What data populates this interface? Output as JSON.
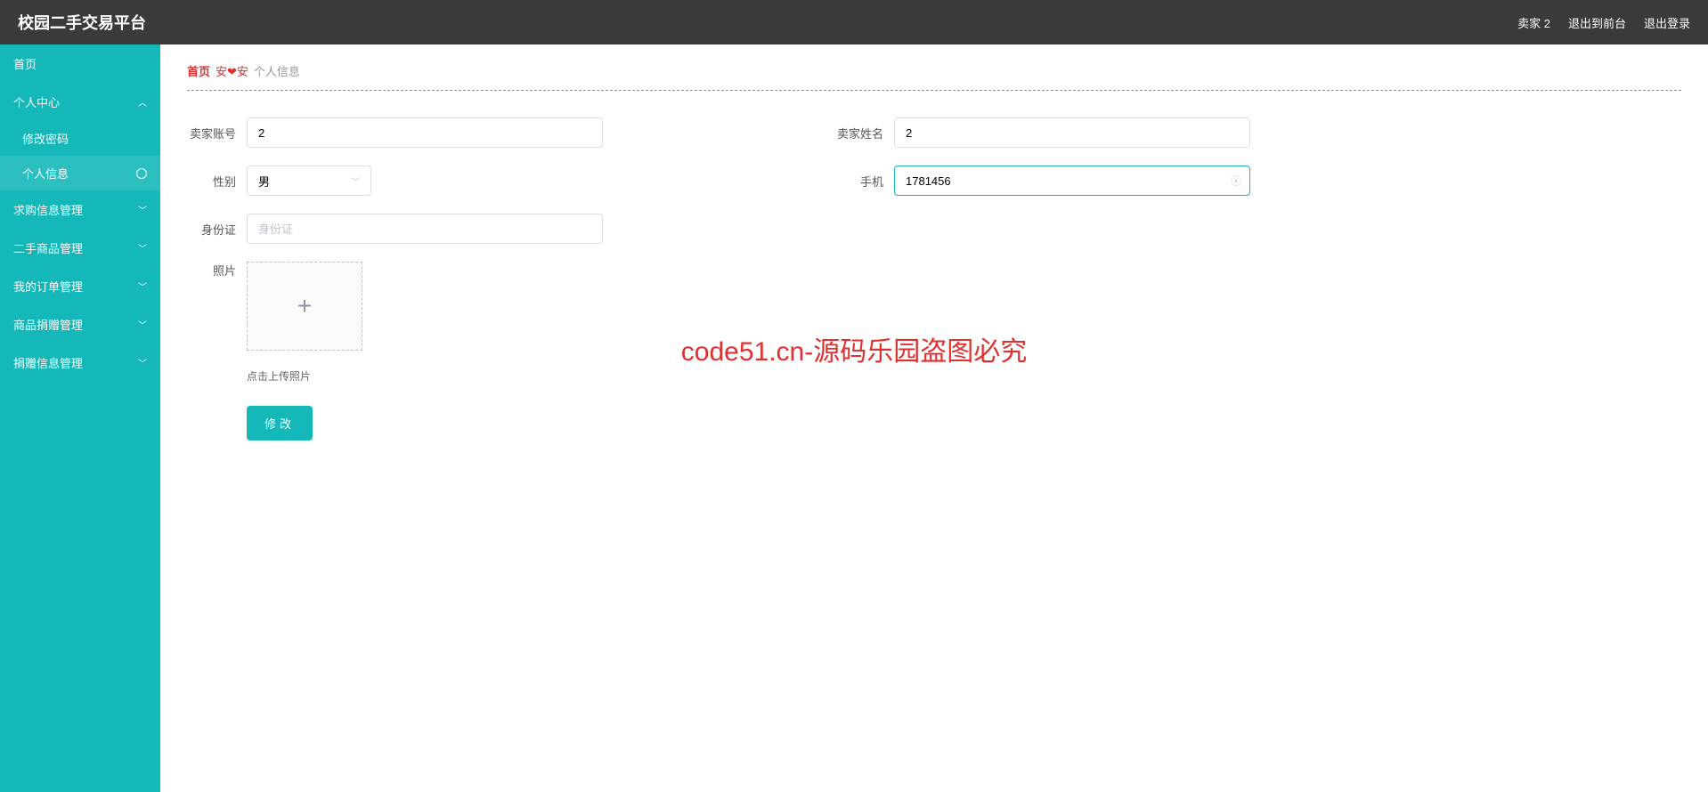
{
  "header": {
    "title": "校园二手交易平台",
    "user_label": "卖家 2",
    "exit_front": "退出到前台",
    "logout": "退出登录"
  },
  "sidebar": {
    "home": "首页",
    "personal_center": "个人中心",
    "change_password": "修改密码",
    "personal_info": "个人信息",
    "purchase_mgmt": "求购信息管理",
    "secondhand_mgmt": "二手商品管理",
    "order_mgmt": "我的订单管理",
    "donation_mgmt": "商品捐赠管理",
    "donation_info_mgmt": "捐赠信息管理"
  },
  "breadcrumb": {
    "home": "首页",
    "heart": "安❤安",
    "current": "个人信息"
  },
  "form": {
    "seller_account_label": "卖家账号",
    "seller_account_value": "2",
    "seller_name_label": "卖家姓名",
    "seller_name_value": "2",
    "gender_label": "性别",
    "gender_value": "男",
    "phone_label": "手机",
    "phone_value": "1781456",
    "id_card_label": "身份证",
    "id_card_placeholder": "身份证",
    "photo_label": "照片",
    "photo_hint": "点击上传照片",
    "submit": "修改"
  },
  "watermark": {
    "text": "code51.cn",
    "center": "code51.cn-源码乐园盗图必究"
  }
}
